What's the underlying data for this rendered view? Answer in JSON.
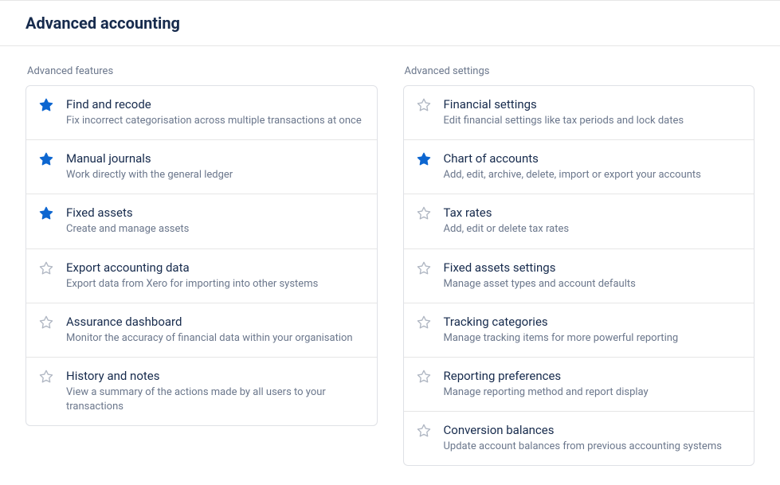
{
  "page": {
    "title": "Advanced accounting"
  },
  "features": {
    "label": "Advanced features",
    "items": [
      {
        "title": "Find and recode",
        "desc": "Fix incorrect categorisation across multiple transactions at once",
        "starred": true
      },
      {
        "title": "Manual journals",
        "desc": "Work directly with the general ledger",
        "starred": true
      },
      {
        "title": "Fixed assets",
        "desc": "Create and manage assets",
        "starred": true
      },
      {
        "title": "Export accounting data",
        "desc": "Export data from Xero for importing into other systems",
        "starred": false
      },
      {
        "title": "Assurance dashboard",
        "desc": "Monitor the accuracy of financial data within your organisation",
        "starred": false
      },
      {
        "title": "History and notes",
        "desc": "View a summary of the actions made by all users to your transactions",
        "starred": false
      }
    ]
  },
  "settings": {
    "label": "Advanced settings",
    "items": [
      {
        "title": "Financial settings",
        "desc": "Edit financial settings like tax periods and lock dates",
        "starred": false
      },
      {
        "title": "Chart of accounts",
        "desc": "Add, edit, archive, delete, import or export your accounts",
        "starred": true
      },
      {
        "title": "Tax rates",
        "desc": "Add, edit or delete tax rates",
        "starred": false
      },
      {
        "title": "Fixed assets settings",
        "desc": "Manage asset types and account defaults",
        "starred": false
      },
      {
        "title": "Tracking categories",
        "desc": "Manage tracking items for more powerful reporting",
        "starred": false
      },
      {
        "title": "Reporting preferences",
        "desc": "Manage reporting method and report display",
        "starred": false
      },
      {
        "title": "Conversion balances",
        "desc": "Update account balances from previous accounting systems",
        "starred": false
      }
    ]
  }
}
